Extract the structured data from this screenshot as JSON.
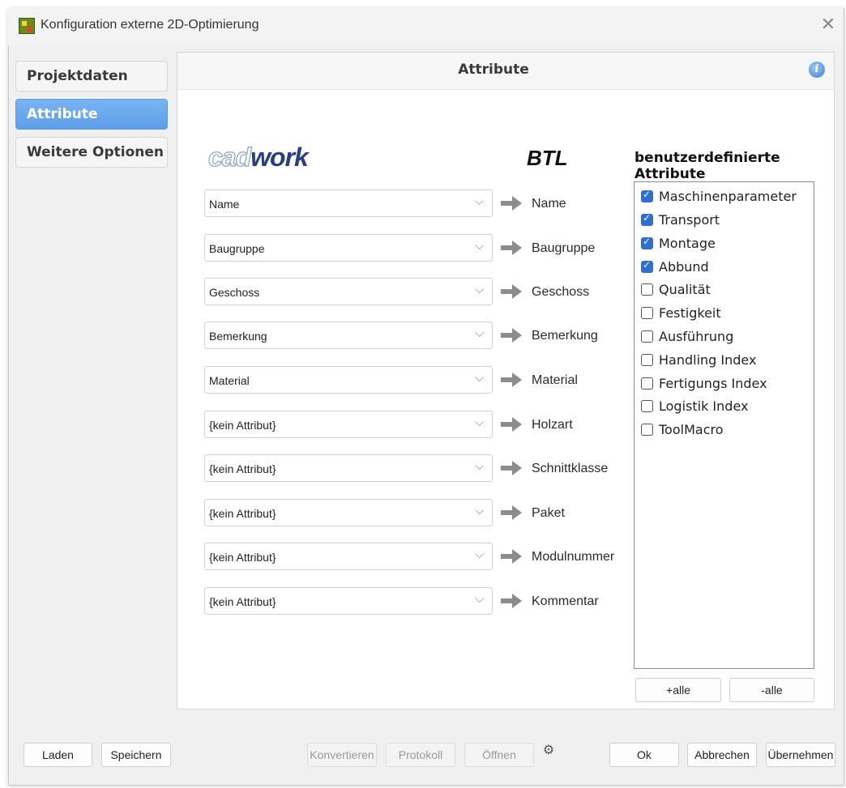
{
  "window": {
    "title": "Konfiguration externe 2D-Optimierung",
    "close_icon": "close-icon"
  },
  "sidebar": {
    "items": [
      {
        "label": "Projektdaten",
        "active": false
      },
      {
        "label": "Attribute",
        "active": true
      },
      {
        "label": "Weitere Optionen",
        "active": false
      }
    ]
  },
  "panel": {
    "title": "Attribute",
    "info_icon": "info-icon"
  },
  "logos": {
    "cadwork_part1": "cad",
    "cadwork_part2": "work",
    "btl": "BTL"
  },
  "custom_attributes_title": "benutzerdefinierte Attribute",
  "mappings": [
    {
      "source": "Name",
      "target": "Name"
    },
    {
      "source": "Baugruppe",
      "target": "Baugruppe"
    },
    {
      "source": "Geschoss",
      "target": "Geschoss"
    },
    {
      "source": "Bemerkung",
      "target": "Bemerkung"
    },
    {
      "source": "Material",
      "target": "Material"
    },
    {
      "source": "{kein Attribut}",
      "target": "Holzart"
    },
    {
      "source": "{kein Attribut}",
      "target": "Schnittklasse"
    },
    {
      "source": "{kein Attribut}",
      "target": "Paket"
    },
    {
      "source": "{kein Attribut}",
      "target": "Modulnummer"
    },
    {
      "source": "{kein Attribut}",
      "target": "Kommentar"
    }
  ],
  "custom_attributes": [
    {
      "label": "Maschinenparameter",
      "checked": true
    },
    {
      "label": "Transport",
      "checked": true
    },
    {
      "label": "Montage",
      "checked": true
    },
    {
      "label": "Abbund",
      "checked": true
    },
    {
      "label": "Qualität",
      "checked": false
    },
    {
      "label": "Festigkeit",
      "checked": false
    },
    {
      "label": "Ausführung",
      "checked": false
    },
    {
      "label": "Handling Index",
      "checked": false
    },
    {
      "label": "Fertigungs Index",
      "checked": false
    },
    {
      "label": "Logistik Index",
      "checked": false
    },
    {
      "label": "ToolMacro",
      "checked": false
    }
  ],
  "list_buttons": {
    "select_all": "+alle",
    "deselect_all": "-alle"
  },
  "footer": {
    "load": "Laden",
    "save": "Speichern",
    "convert": "Konvertieren",
    "log": "Protokoll",
    "open": "Öffnen",
    "link_icon": "link-settings-icon",
    "ok": "Ok",
    "cancel": "Abbrechen",
    "apply": "Übernehmen"
  },
  "colors": {
    "active_nav": "#5d9ee8",
    "checkbox_checked": "#2e6fcf",
    "logo_dark": "#283d82"
  }
}
